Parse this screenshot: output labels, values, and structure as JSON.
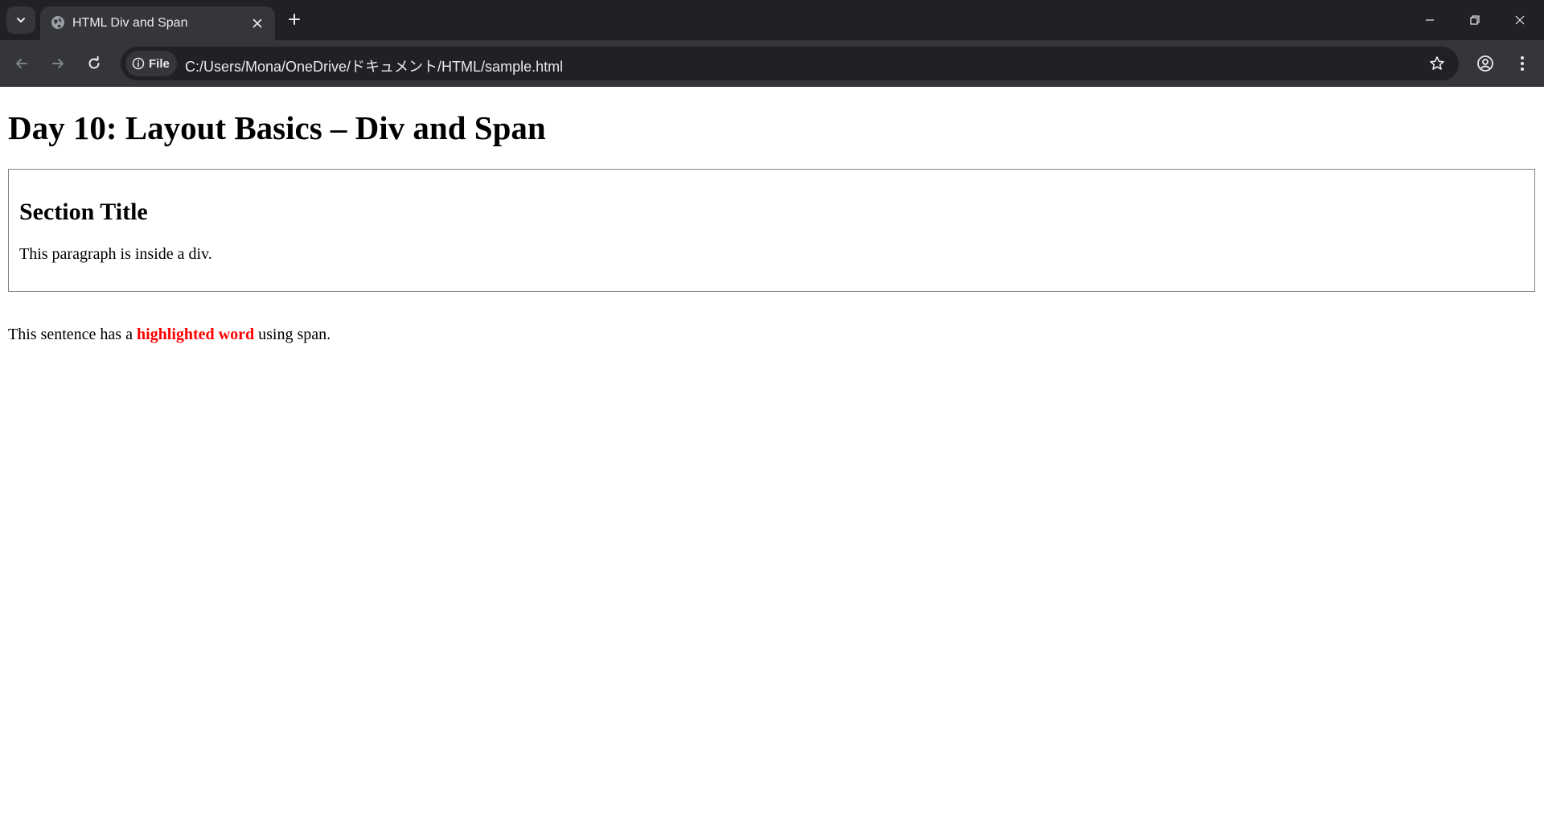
{
  "browser": {
    "tab": {
      "title": "HTML Div and Span"
    },
    "address_bar": {
      "chip_label": "File",
      "url": "C:/Users/Mona/OneDrive/ドキュメント/HTML/sample.html"
    },
    "icons": {
      "tab_search": "chevron-down-icon",
      "favicon": "globe-icon",
      "tab_close": "close-icon",
      "new_tab": "plus-icon",
      "minimize": "minimize-icon",
      "restore": "restore-icon",
      "close_window": "close-icon",
      "back": "back-arrow-icon",
      "forward": "forward-arrow-icon",
      "reload": "reload-icon",
      "info": "info-icon",
      "bookmark": "star-icon",
      "profile": "profile-icon",
      "menu": "kebab-menu-icon"
    },
    "colors": {
      "tab_strip": "#202124",
      "toolbar": "#35363a",
      "omnibox": "#202124",
      "text": "#e8eaed"
    }
  },
  "page": {
    "heading": "Day 10: Layout Basics – Div and Span",
    "section": {
      "title": "Section Title",
      "paragraph": "This paragraph is inside a div."
    },
    "sentence": {
      "before": "This sentence has a ",
      "highlight": "highlighted word",
      "after": " using span."
    },
    "colors": {
      "highlight": "#ff0000",
      "div_border": "#808080"
    }
  }
}
